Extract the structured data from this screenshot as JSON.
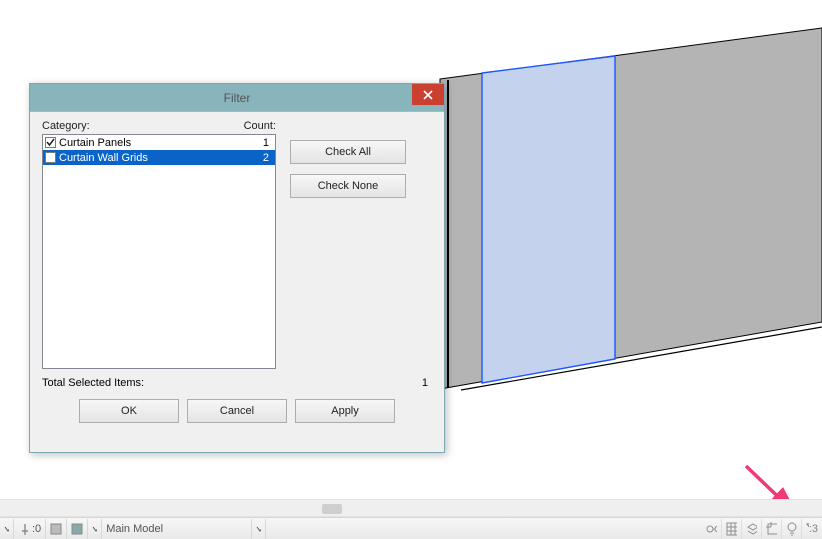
{
  "dialog": {
    "title": "Filter",
    "category_header": "Category:",
    "count_header": "Count:",
    "items": [
      {
        "name": "Curtain Panels",
        "count": "1",
        "checked": true,
        "selected": false
      },
      {
        "name": "Curtain Wall Grids",
        "count": "2",
        "checked": false,
        "selected": true
      }
    ],
    "check_all_label": "Check All",
    "check_none_label": "Check None",
    "total_label": "Total Selected Items:",
    "total_value": "1",
    "ok_label": "OK",
    "cancel_label": "Cancel",
    "apply_label": "Apply"
  },
  "status": {
    "selinfo": ":0",
    "model_label": "Main Model",
    "filter_count": ":3"
  },
  "colors": {
    "titlebar": "#88b4bc",
    "close": "#c94030",
    "selection_row": "#0a64c8",
    "panel_highlight": "#c5d2ed",
    "panel_shade": "#b4b4b4",
    "selection_edge": "#1c56ff",
    "arrow": "#f03a77"
  }
}
